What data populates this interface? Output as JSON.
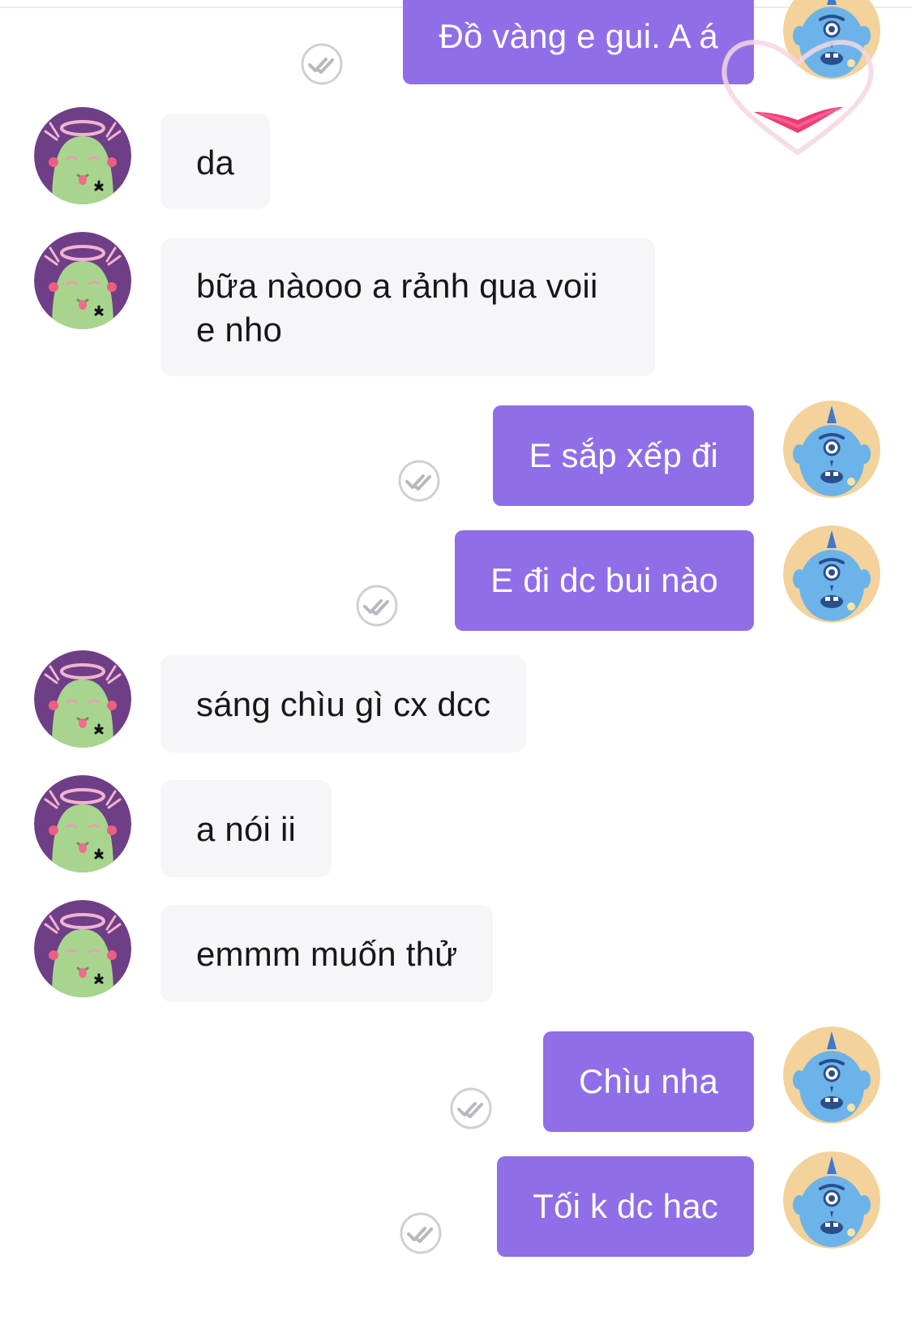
{
  "conversation": {
    "messages": [
      {
        "side": "out",
        "text": "Đồ vàng e gui. A á",
        "status": "seen-check-icon"
      },
      {
        "side": "in",
        "text": "da"
      },
      {
        "side": "in",
        "text": "bữa nàooo a rảnh qua voii e nho"
      },
      {
        "side": "out",
        "text": "E sắp xếp đi",
        "status": "seen-check-icon"
      },
      {
        "side": "out",
        "text": "E đi dc bui nào",
        "status": "seen-check-icon"
      },
      {
        "side": "in",
        "text": "sáng chìu gì cx dcc"
      },
      {
        "side": "in",
        "text": "a nói ii"
      },
      {
        "side": "in",
        "text": "emmm muốn thử"
      },
      {
        "side": "out",
        "text": "Chìu nha",
        "status": "seen-check-icon"
      },
      {
        "side": "out",
        "text": "Tối k dc hac",
        "status": "seen-check-icon"
      }
    ],
    "reaction": "heart-reaction-icon"
  },
  "theme": {
    "outgoing_bubble": "#8f6ee8",
    "incoming_bubble": "#f6f6f8",
    "incoming_text": "#16161e",
    "outgoing_text": "#ffffff",
    "check_color": "#b8b8c0"
  },
  "avatars": {
    "incoming": "green-alien-avatar-icon",
    "outgoing": "blue-cyclops-monster-avatar-icon"
  }
}
